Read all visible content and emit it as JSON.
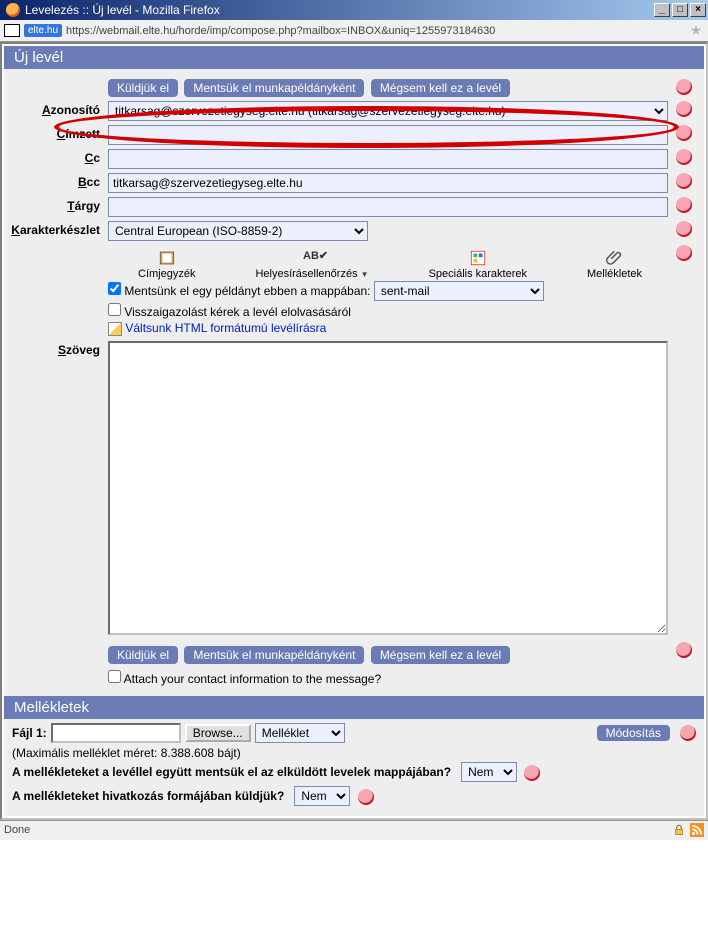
{
  "window": {
    "title": "Levelezés :: Új levél - Mozilla Firefox"
  },
  "address": {
    "badge": "elte.hu",
    "url": "https://webmail.elte.hu/horde/imp/compose.php?mailbox=INBOX&uniq=1255973184630"
  },
  "headers": {
    "compose": "Új levél",
    "attachments": "Mellékletek"
  },
  "buttons": {
    "send": "Küldjük el",
    "save_draft": "Mentsük el munkapéldányként",
    "cancel": "Mégsem kell ez a levél",
    "browse": "Browse...",
    "modify": "Módosítás"
  },
  "labels": {
    "identity_pre": "A",
    "identity_post": "zonosító",
    "to_pre": "C",
    "to_post": "ímzett",
    "cc_pre": "C",
    "cc_post": "c",
    "bcc_pre": "B",
    "bcc_post": "cc",
    "subject_pre": "T",
    "subject_post": "árgy",
    "charset_pre": "K",
    "charset_post": "arakterkészlet",
    "body_pre": "S",
    "body_post": "zöveg",
    "file1": "Fájl 1:"
  },
  "fields": {
    "identity": "titkarsag@szervezetiegyseg.elte.hu (titkarsag@szervezetiegyseg.elte.hu)",
    "to": "",
    "cc": "",
    "bcc": "titkarsag@szervezetiegyseg.elte.hu",
    "subject": "",
    "charset": "Central European (ISO-8859-2)",
    "sent_folder": "sent-mail",
    "attachment_type": "Melléklet"
  },
  "toolbar": {
    "addressbook": "Címjegyzék",
    "spellcheck": "Helyesírásellenőrzés",
    "special_chars": "Speciális karakterek",
    "attachments": "Mellékletek"
  },
  "options": {
    "save_sent": "Mentsünk el egy példányt ebben a mappában:",
    "read_receipt": "Visszaigazolást kérek a levél elolvasásáról",
    "html_switch": "Váltsunk HTML formátumú levélírásra",
    "attach_contact": "Attach your contact information to the message?"
  },
  "attachments": {
    "max_size": "(Maximális melléklet méret: 8.388.608 bájt)",
    "q1": "A mellékleteket a levéllel együtt mentsük el az elküldött levelek mappájában?",
    "q2": "A mellékleteket hivatkozás formájában küldjük?",
    "a_no": "Nem"
  },
  "status": {
    "text": "Done"
  }
}
